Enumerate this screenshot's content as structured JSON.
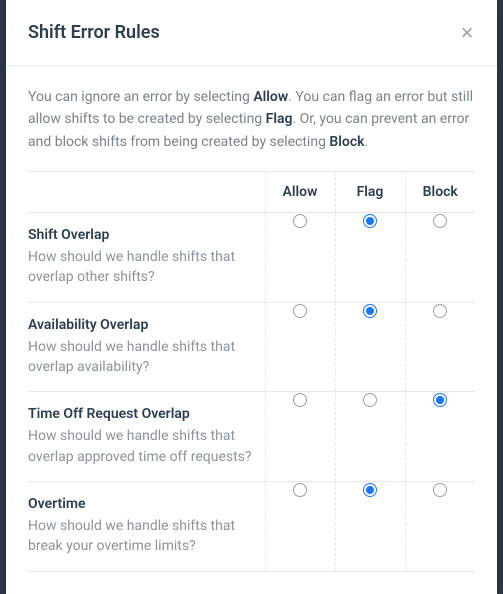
{
  "modal": {
    "title": "Shift Error Rules",
    "intro_parts": {
      "p1": "You can ignore an error by selecting ",
      "b1": "Allow",
      "p2": ". You can flag an error but still allow shifts to be created by selecting ",
      "b2": "Flag",
      "p3": ". Or, you can prevent an error and block shifts from being created by selecting ",
      "b3": "Block",
      "p4": "."
    }
  },
  "columns": {
    "allow": "Allow",
    "flag": "Flag",
    "block": "Block"
  },
  "rules": [
    {
      "title": "Shift Overlap",
      "desc": "How should we handle shifts that overlap other shifts?",
      "selected": "flag"
    },
    {
      "title": "Availability Overlap",
      "desc": "How should we handle shifts that overlap availability?",
      "selected": "flag"
    },
    {
      "title": "Time Off Request Overlap",
      "desc": "How should we handle shifts that overlap approved time off requests?",
      "selected": "block"
    },
    {
      "title": "Overtime",
      "desc": "How should we handle shifts that break your overtime limits?",
      "selected": "flag"
    }
  ]
}
